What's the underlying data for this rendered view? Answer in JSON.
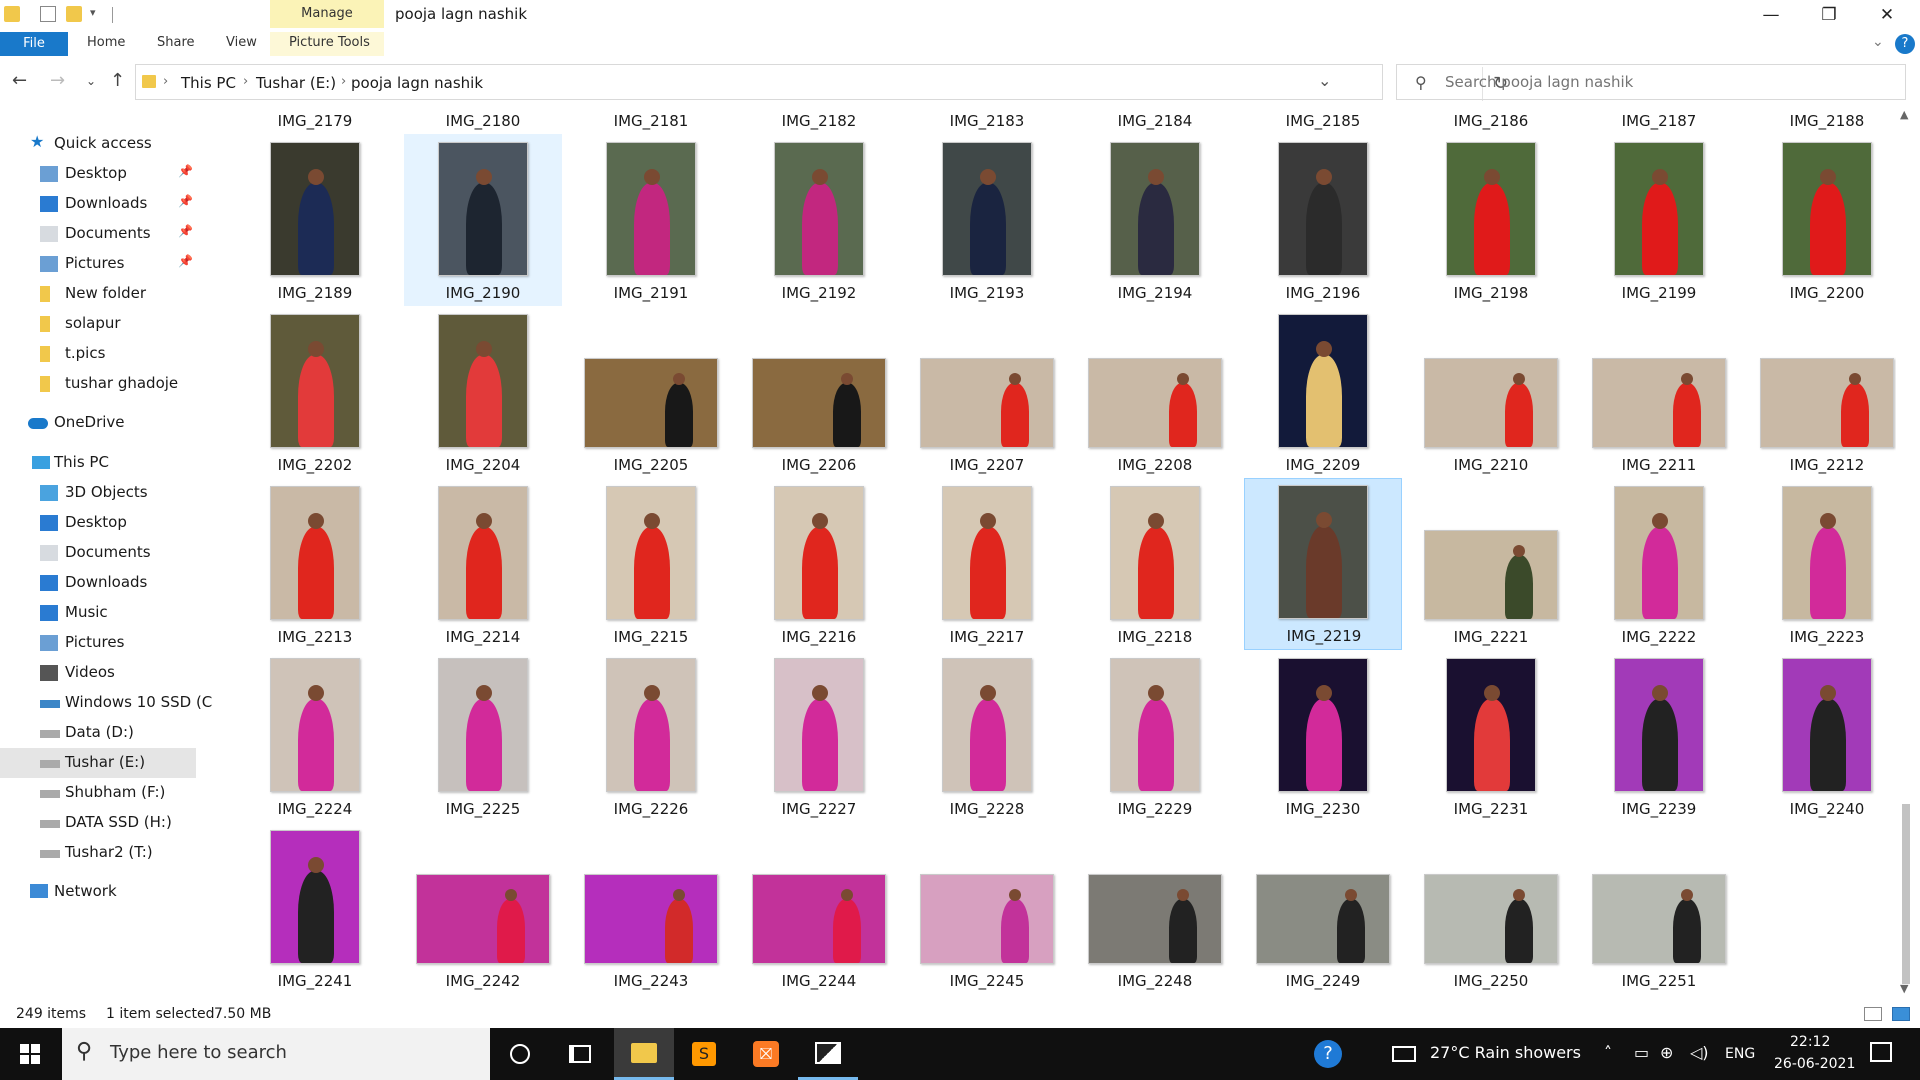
{
  "window": {
    "title": "pooja lagn nashik",
    "manage_tab": "Manage",
    "picture_tools_tab": "Picture Tools",
    "minimize_glyph": "—",
    "restore_glyph": "❐",
    "close_glyph": "✕"
  },
  "ribbon": {
    "file": "File",
    "home": "Home",
    "share": "Share",
    "view": "View"
  },
  "address": {
    "crumbs": [
      "This PC",
      "Tushar (E:)",
      "pooja lagn nashik"
    ],
    "search_placeholder": "Search pooja lagn nashik"
  },
  "nav": {
    "quick_access": "Quick access",
    "quick_items": [
      "Desktop",
      "Downloads",
      "Documents",
      "Pictures",
      "New folder",
      "solapur",
      "t.pics",
      "tushar ghadoje"
    ],
    "onedrive": "OneDrive",
    "this_pc": "This PC",
    "pc_items": [
      "3D Objects",
      "Desktop",
      "Documents",
      "Downloads",
      "Music",
      "Pictures",
      "Videos",
      "Windows 10 SSD (C",
      "Data (D:)",
      "Tushar (E:)",
      "Shubham (F:)",
      "DATA SSD (H:)",
      "Tushar2 (T:)"
    ],
    "network": "Network"
  },
  "files": {
    "top_row": [
      "IMG_2179",
      "IMG_2180",
      "IMG_2181",
      "IMG_2182",
      "IMG_2183",
      "IMG_2184",
      "IMG_2185",
      "IMG_2186",
      "IMG_2187",
      "IMG_2188"
    ],
    "rows": [
      [
        "IMG_2189",
        "IMG_2190",
        "IMG_2191",
        "IMG_2192",
        "IMG_2193",
        "IMG_2194",
        "IMG_2196",
        "IMG_2198",
        "IMG_2199",
        "IMG_2200"
      ],
      [
        "IMG_2202",
        "IMG_2204",
        "IMG_2205",
        "IMG_2206",
        "IMG_2207",
        "IMG_2208",
        "IMG_2209",
        "IMG_2210",
        "IMG_2211",
        "IMG_2212"
      ],
      [
        "IMG_2213",
        "IMG_2214",
        "IMG_2215",
        "IMG_2216",
        "IMG_2217",
        "IMG_2218",
        "IMG_2219",
        "IMG_2221",
        "IMG_2222",
        "IMG_2223"
      ],
      [
        "IMG_2224",
        "IMG_2225",
        "IMG_2226",
        "IMG_2227",
        "IMG_2228",
        "IMG_2229",
        "IMG_2230",
        "IMG_2231",
        "IMG_2239",
        "IMG_2240"
      ],
      [
        "IMG_2241",
        "IMG_2242",
        "IMG_2243",
        "IMG_2244",
        "IMG_2245",
        "IMG_2248",
        "IMG_2249",
        "IMG_2250",
        "IMG_2251"
      ]
    ]
  },
  "status": {
    "count": "249 items",
    "selection": "1 item selected",
    "size": "7.50 MB"
  },
  "taskbar": {
    "search_text": "Type here to search",
    "weather": "27°C  Rain showers",
    "lang": "ENG",
    "time": "22:12",
    "date": "26-06-2021"
  },
  "colors": {
    "accent": "#1979ca",
    "selection": "#cce8ff",
    "manage_tab": "#fbf3b7"
  }
}
